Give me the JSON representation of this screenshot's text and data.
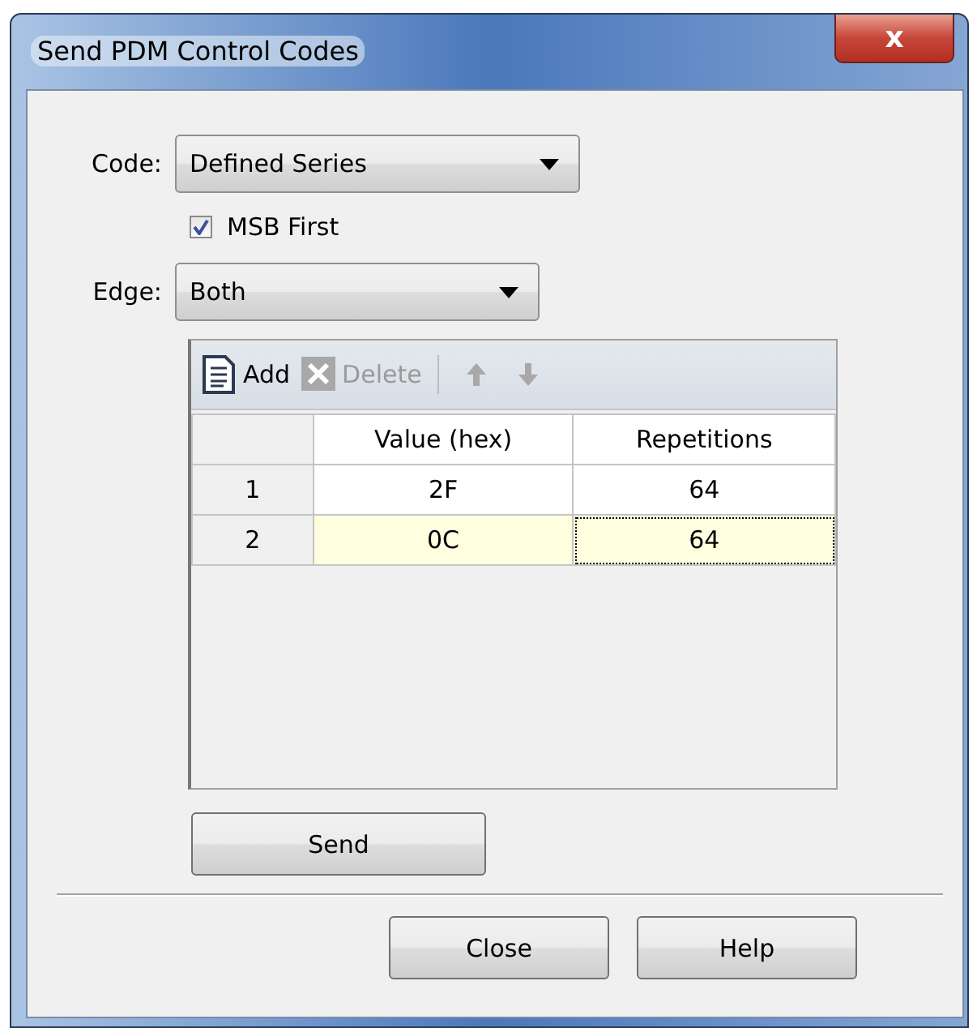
{
  "window": {
    "title": "Send PDM Control Codes",
    "close_glyph": "x"
  },
  "code": {
    "label": "Code:",
    "value": "Defined Series"
  },
  "msb_first": {
    "label": "MSB First",
    "checked": true
  },
  "edge": {
    "label": "Edge:",
    "value": "Both"
  },
  "toolbar": [
    {
      "kind": "add",
      "label": "Add",
      "disabled": false
    },
    {
      "kind": "delete",
      "label": "Delete",
      "disabled": true
    },
    {
      "kind": "up",
      "disabled": true
    },
    {
      "kind": "down",
      "disabled": true
    }
  ],
  "table": {
    "columns": [
      "Value (hex)",
      "Repetitions"
    ],
    "rows": [
      {
        "index": "1",
        "cells": [
          {
            "text": "2F",
            "focused": false
          },
          {
            "text": "64",
            "focused": false
          }
        ],
        "selected": false
      },
      {
        "index": "2",
        "cells": [
          {
            "text": "0C",
            "focused": false
          },
          {
            "text": "64",
            "focused": true
          }
        ],
        "selected": true
      }
    ]
  },
  "send_button": "Send",
  "buttons": [
    "Close",
    "Help"
  ]
}
